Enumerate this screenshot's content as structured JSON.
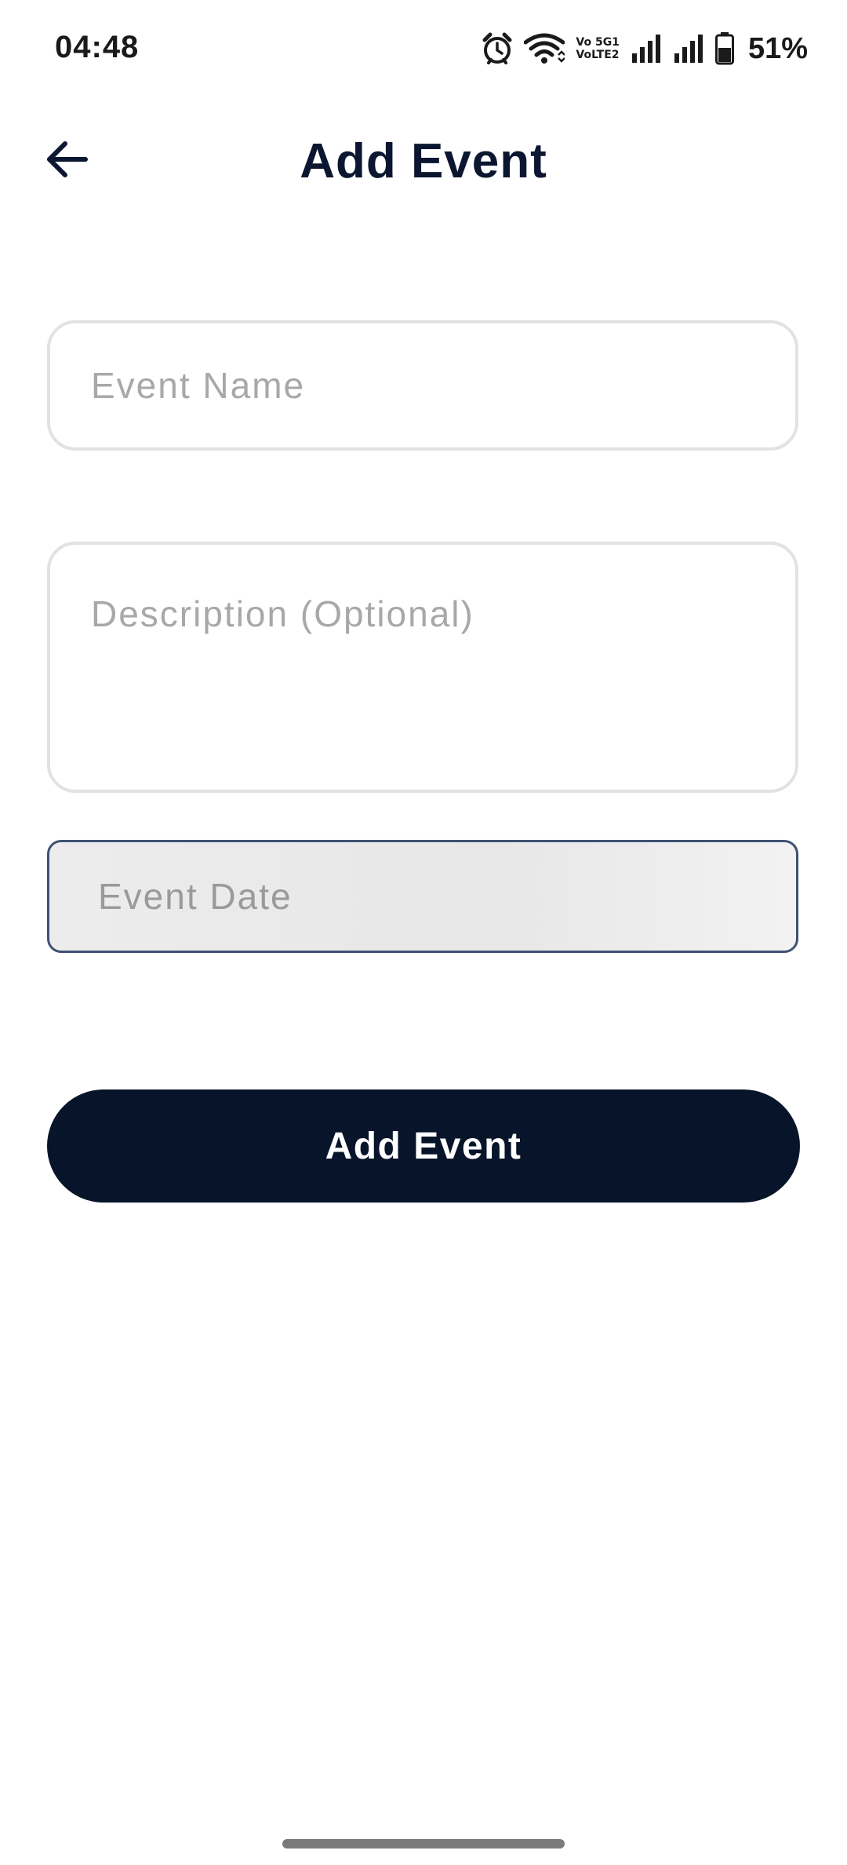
{
  "status_bar": {
    "time": "04:48",
    "icons": [
      "alarm-icon",
      "wifi-icon",
      "volte-5g-icon",
      "signal-icon",
      "signal-icon",
      "battery-icon"
    ],
    "volte_line1": "Vo 5G1",
    "volte_line2": "VoLTE2",
    "battery_percent": "51%"
  },
  "app_bar": {
    "back_icon": "arrow-left-icon",
    "title": "Add Event"
  },
  "form": {
    "event_name": {
      "value": "",
      "placeholder": "Event Name"
    },
    "description": {
      "value": "",
      "placeholder": "Description (Optional)"
    },
    "event_date": {
      "placeholder": "Event Date"
    },
    "submit_label": "Add Event"
  },
  "colors": {
    "primary": "#071429",
    "title": "#0b1630",
    "placeholder": "#a8a8a8",
    "border": "#e2e2e2",
    "date_border": "#3d5273"
  }
}
